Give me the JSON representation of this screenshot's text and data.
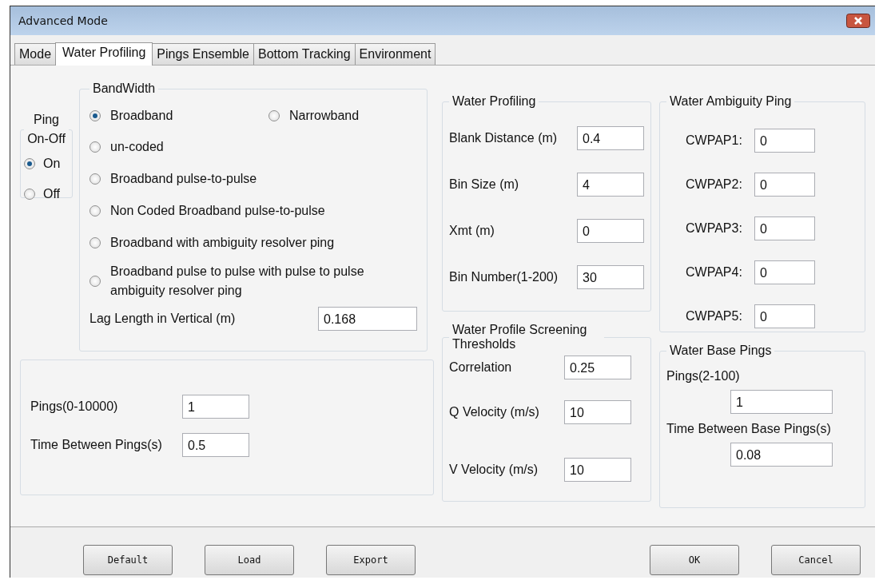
{
  "window": {
    "title": "Advanced Mode"
  },
  "tabs": [
    {
      "label": "Mode",
      "selected": false
    },
    {
      "label": "Water Profiling",
      "selected": true
    },
    {
      "label": "Pings Ensemble",
      "selected": false
    },
    {
      "label": "Bottom Tracking",
      "selected": false
    },
    {
      "label": "Environment",
      "selected": false
    }
  ],
  "ping_on_off": {
    "title": "Ping On-Off",
    "options": [
      {
        "label": "On",
        "selected": true
      },
      {
        "label": "Off",
        "selected": false
      }
    ]
  },
  "bandwidth": {
    "title": "BandWidth",
    "options": [
      {
        "label": "Broadband",
        "selected": true
      },
      {
        "label": "Narrowband",
        "selected": false
      },
      {
        "label": "un-coded",
        "selected": false
      },
      {
        "label": "Broadband pulse-to-pulse",
        "selected": false
      },
      {
        "label": "Non Coded Broadband pulse-to-pulse",
        "selected": false
      },
      {
        "label": "Broadband with ambiguity resolver ping",
        "selected": false
      },
      {
        "label": "Broadband pulse to pulse with pulse to pulse ambiguity resolver ping",
        "selected": false
      }
    ],
    "lag_length": {
      "label": "Lag Length in Vertical  (m)",
      "value": "0.168"
    }
  },
  "pings": {
    "fields": [
      {
        "label": "Pings(0-10000)",
        "value": "1"
      },
      {
        "label": "Time Between Pings(s)",
        "value": "0.5"
      }
    ]
  },
  "water_profiling": {
    "title": "Water Profiling",
    "fields": [
      {
        "label": "Blank Distance  (m)",
        "value": "0.4"
      },
      {
        "label": "Bin Size  (m)",
        "value": "4"
      },
      {
        "label": "Xmt   (m)",
        "value": "0"
      },
      {
        "label": "Bin Number(1-200)",
        "value": "30"
      }
    ]
  },
  "screening": {
    "title": "Water Profile Screening Thresholds",
    "fields": [
      {
        "label": "Correlation",
        "value": "0.25"
      },
      {
        "label": "Q Velocity   (m/s)",
        "value": "10"
      },
      {
        "label": "V Velocity   (m/s)",
        "value": "10"
      }
    ]
  },
  "ambiguity": {
    "title": "Water Ambiguity Ping",
    "fields": [
      {
        "label": "CWPAP1:",
        "value": "0"
      },
      {
        "label": "CWPAP2:",
        "value": "0"
      },
      {
        "label": "CWPAP3:",
        "value": "0"
      },
      {
        "label": "CWPAP4:",
        "value": "0"
      },
      {
        "label": "CWPAP5:",
        "value": "0"
      }
    ]
  },
  "base_pings": {
    "title": "Water Base Pings",
    "fields": [
      {
        "label": "Pings(2-100)",
        "value": "1"
      },
      {
        "label": "Time Between Base Pings(s)",
        "value": "0.08"
      }
    ]
  },
  "buttons_left": [
    "Default",
    "Load",
    "Export"
  ],
  "buttons_right": [
    "OK",
    "Cancel"
  ]
}
